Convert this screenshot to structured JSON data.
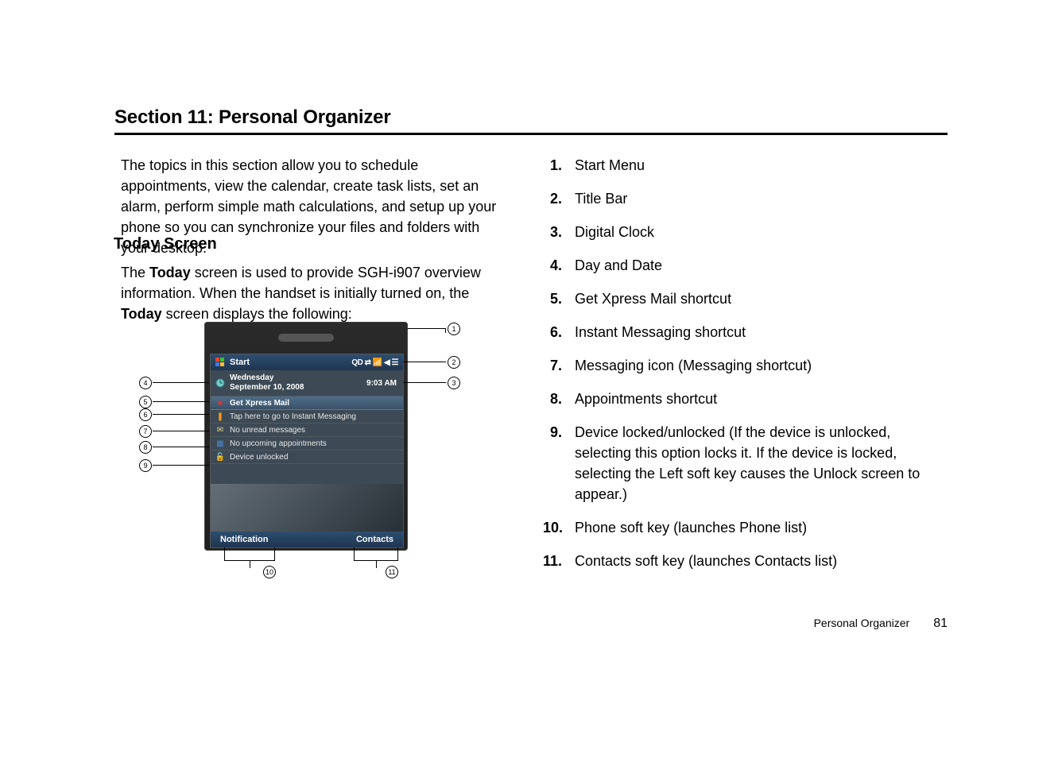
{
  "section_title": "Section 11: Personal Organizer",
  "intro": "The topics in this section allow you to schedule appointments, view the calendar, create task lists, set an alarm, perform simple math calculations, and setup up your phone so you can synchronize your files and folders with your desktop.",
  "today_heading": "Today Screen",
  "today_para_pre": "The ",
  "today_para_b1": "Today",
  "today_para_mid": " screen is used to provide SGH-i907 overview information. When the handset is initially turned on, the ",
  "today_para_b2": "Today",
  "today_para_post": " screen displays the following:",
  "phone": {
    "titlebar_start": "Start",
    "titlebar_icons": "QD  ⇄  📶  ◀  ☰",
    "day": "Wednesday",
    "date": "September 10, 2008",
    "clock": "9:03 AM",
    "rows": {
      "xpress": "Get Xpress Mail",
      "im": "Tap here to go to Instant Messaging",
      "msg": "No unread messages",
      "appt": "No upcoming appointments",
      "lock": "Device unlocked"
    },
    "soft_left": "Notification",
    "soft_right": "Contacts"
  },
  "callouts_left": {
    "c4": "4",
    "c5": "5",
    "c6": "6",
    "c7": "7",
    "c8": "8",
    "c9": "9"
  },
  "callouts_top_right": {
    "c1": "1",
    "c2": "2",
    "c3": "3"
  },
  "callouts_bottom": {
    "c10": "10",
    "c11": "11"
  },
  "legend": [
    {
      "num": "1.",
      "text": "Start Menu"
    },
    {
      "num": "2.",
      "text": "Title Bar"
    },
    {
      "num": "3.",
      "text": "Digital Clock"
    },
    {
      "num": "4.",
      "text": "Day and Date"
    },
    {
      "num": "5.",
      "text": "Get Xpress Mail shortcut"
    },
    {
      "num": "6.",
      "text": "Instant Messaging shortcut"
    },
    {
      "num": "7.",
      "text": "Messaging icon (Messaging shortcut)"
    },
    {
      "num": "8.",
      "text": "Appointments shortcut"
    },
    {
      "num": "9.",
      "text": "Device locked/unlocked (If the device is unlocked, selecting this option locks it. If the device is locked, selecting the Left soft key causes the Unlock screen to appear.)"
    },
    {
      "num": "10.",
      "text": "Phone soft key (launches Phone list)"
    },
    {
      "num": "11.",
      "text": "Contacts soft key (launches Contacts list)"
    }
  ],
  "footer_label": "Personal Organizer",
  "footer_page": "81"
}
